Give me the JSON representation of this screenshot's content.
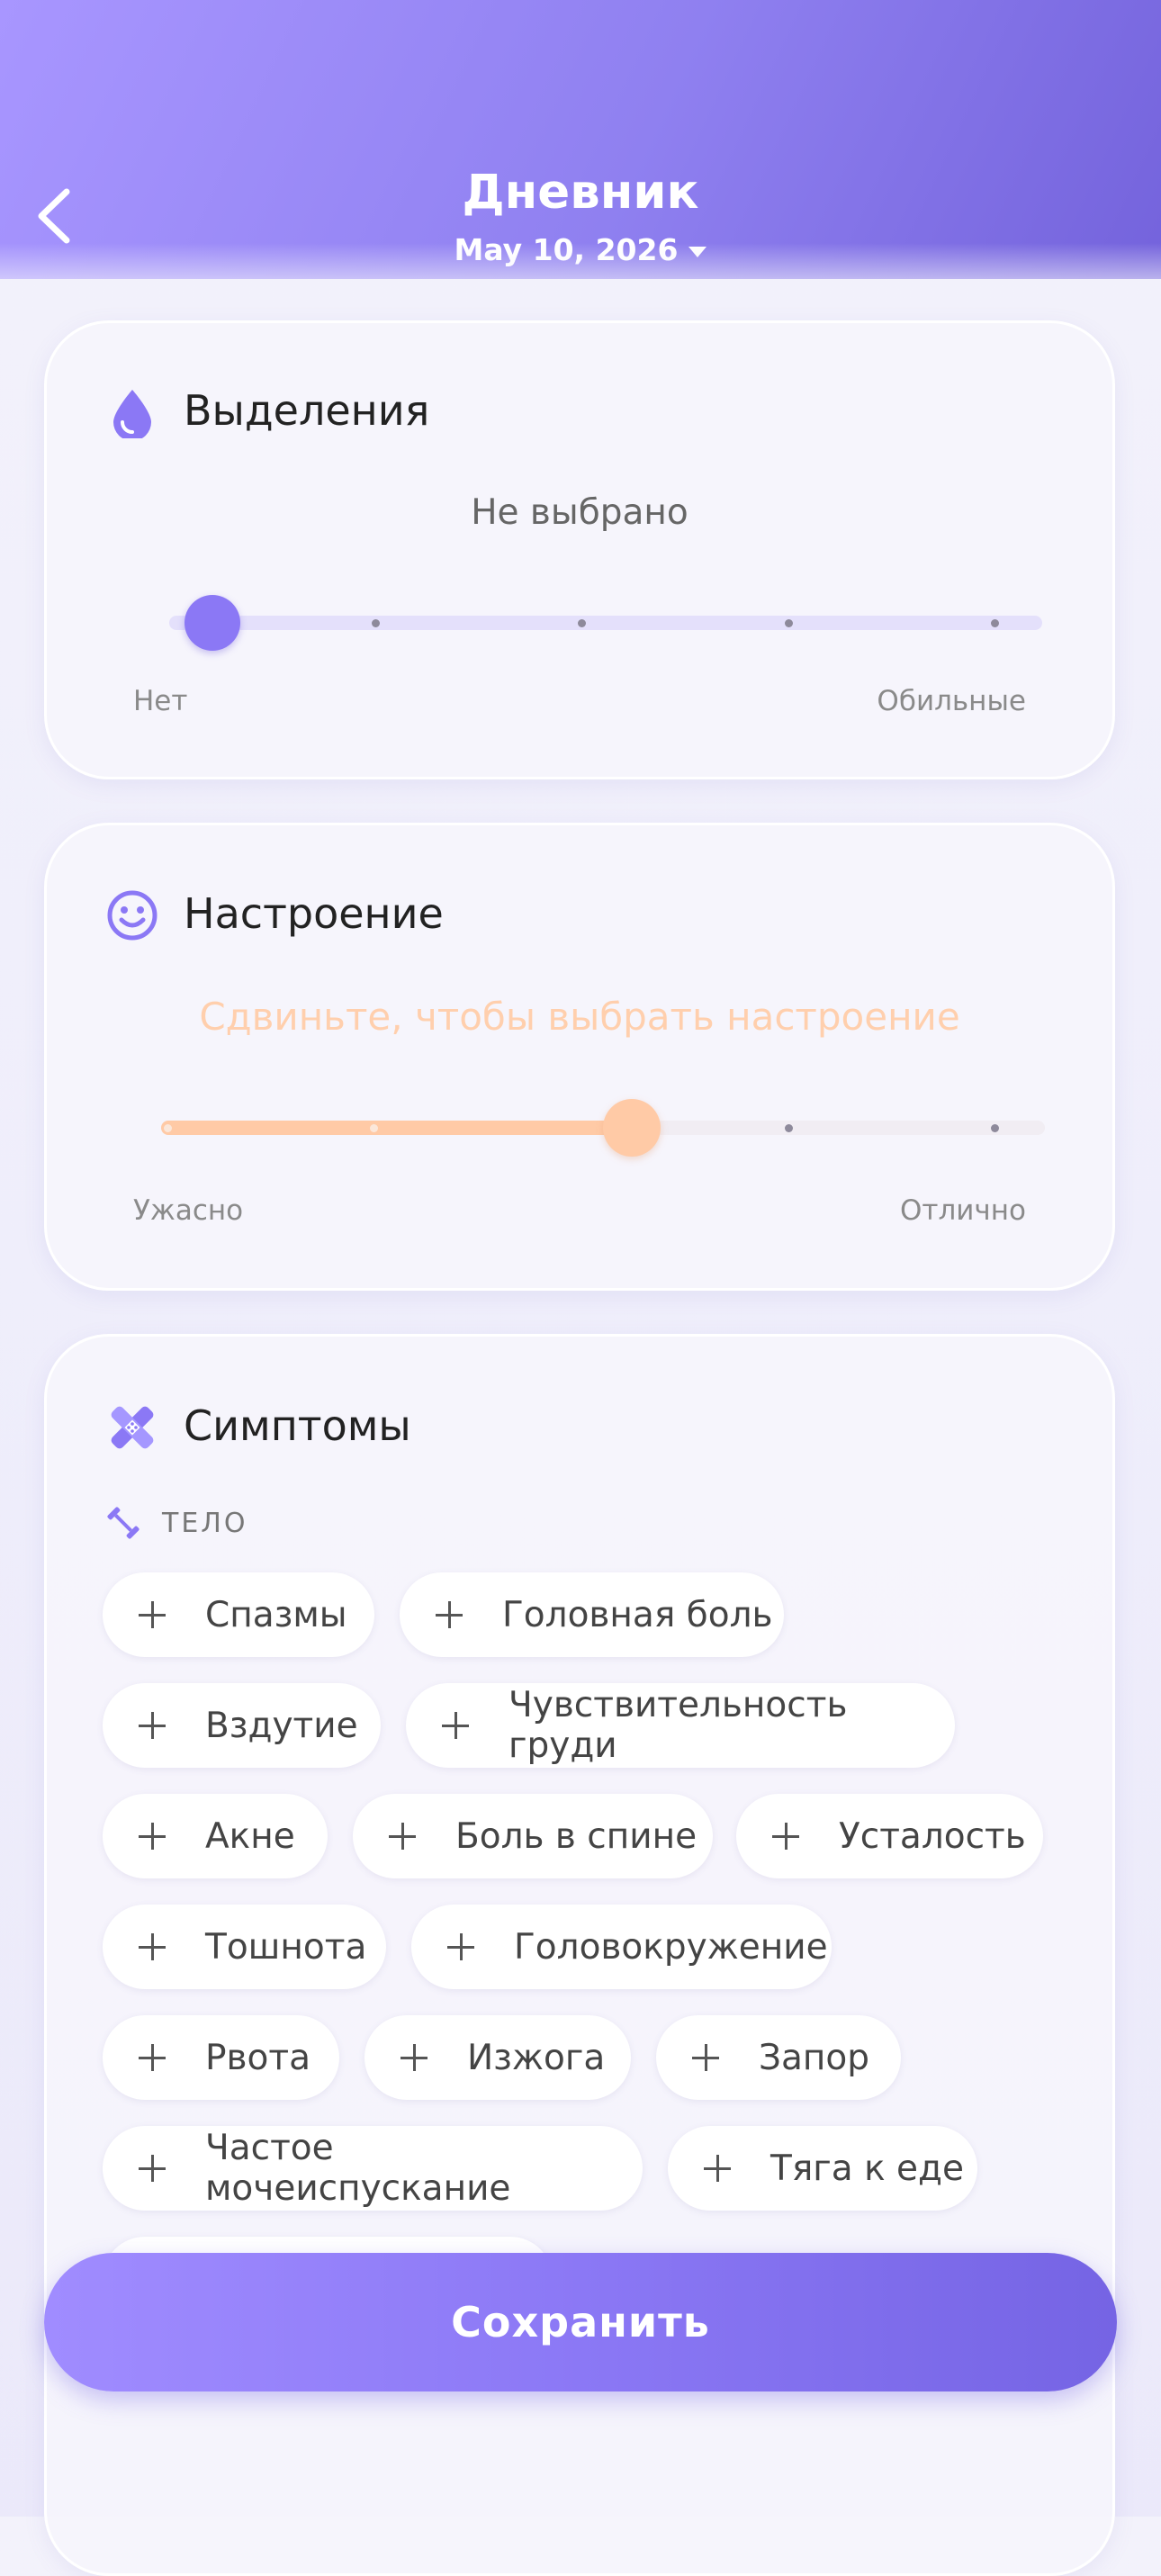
{
  "header": {
    "title": "Дневник",
    "date": "May 10, 2026"
  },
  "discharge": {
    "title": "Выделения",
    "status": "Не выбрано",
    "min_label": "Нет",
    "max_label": "Обильные",
    "level_fraction": 0,
    "icon": "drop-icon"
  },
  "mood": {
    "title": "Настроение",
    "hint": "Сдвиньте, чтобы выбрать настроение",
    "min_label": "Ужасно",
    "max_label": "Отлично",
    "level_fraction": 0.5,
    "icon": "smiley-icon"
  },
  "symptoms": {
    "title": "Симптомы",
    "icon": "bandage-icon",
    "section_label": "ТЕЛО",
    "section_icon": "dumbbell-icon",
    "chips": [
      "Спазмы",
      "Головная боль",
      "Вздутие",
      "Чувствительность груди",
      "Акне",
      "Боль в спине",
      "Усталость",
      "Тошнота",
      "Головокружение",
      "Рвота",
      "Изжога",
      "Запор",
      "Частое мочеиспускание",
      "Тяга к еде"
    ]
  },
  "footer": {
    "save_label": "Сохранить"
  },
  "colors": {
    "accent": "#8b78f5",
    "mood": "#ffc9a3",
    "track": "#e4e0fb"
  }
}
